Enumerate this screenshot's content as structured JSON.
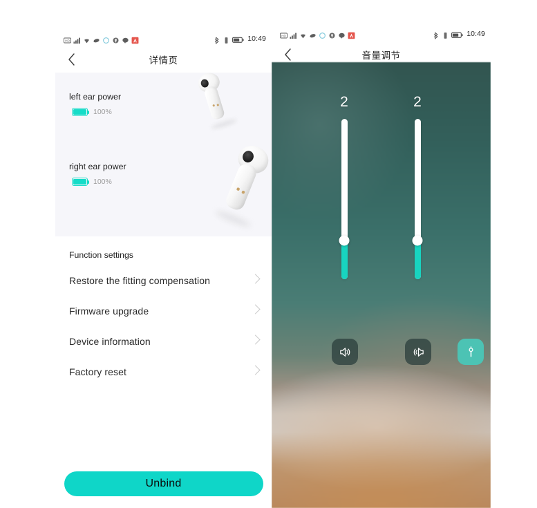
{
  "left_phone": {
    "status_bar": {
      "icons": [
        "hd-icon",
        "signal-bars-icon",
        "wifi-icon",
        "mute-icon",
        "sync-icon",
        "headset-icon",
        "message-icon",
        "app-badge-icon"
      ],
      "right_icons": [
        "bluetooth-icon",
        "vibrate-icon",
        "battery-icon"
      ],
      "time": "10:49"
    },
    "nav": {
      "back_icon": "chevron-left-icon",
      "title": "详情页"
    },
    "battery_card": {
      "left": {
        "label": "left ear power",
        "percent": "100%",
        "icon": "battery-icon",
        "image": "left-earbud-photo"
      },
      "right": {
        "label": "right ear power",
        "percent": "100%",
        "icon": "battery-icon",
        "image": "right-earbud-photo"
      }
    },
    "function_section": {
      "header": "Function settings",
      "items": [
        {
          "label": "Restore the fitting compensation",
          "chevron": "chevron-right-icon"
        },
        {
          "label": "Firmware upgrade",
          "chevron": "chevron-right-icon"
        },
        {
          "label": "Device information",
          "chevron": "chevron-right-icon"
        },
        {
          "label": "Factory reset",
          "chevron": "chevron-right-icon"
        }
      ]
    },
    "unbind_button": "Unbind"
  },
  "right_phone": {
    "status_bar": {
      "icons": [
        "hd-icon",
        "signal-bars-icon",
        "wifi-icon",
        "mute-icon",
        "sync-icon",
        "headset-icon",
        "message-icon",
        "app-badge-icon"
      ],
      "right_icons": [
        "bluetooth-icon",
        "vibrate-icon",
        "battery-icon"
      ],
      "time": "10:49"
    },
    "nav": {
      "back_icon": "chevron-left-icon",
      "title": "音量调节"
    },
    "sliders": [
      {
        "name": "left-channel-volume",
        "value": "2"
      },
      {
        "name": "right-channel-volume",
        "value": "2"
      }
    ],
    "buttons": [
      {
        "name": "left-speaker-button",
        "icon": "speaker-left-icon",
        "active": "false"
      },
      {
        "name": "right-speaker-button",
        "icon": "speaker-right-icon",
        "active": "false"
      },
      {
        "name": "link-channels-button",
        "icon": "link-icon",
        "active": "true"
      }
    ]
  },
  "colors": {
    "accent_teal": "#0fd6c8",
    "slider_fill": "#18d4c0",
    "button_teal": "#4cc3b4",
    "card_bg": "#f6f6fa",
    "chevron_gray": "#c9c9c9",
    "percent_gray": "#9b9b9b"
  }
}
